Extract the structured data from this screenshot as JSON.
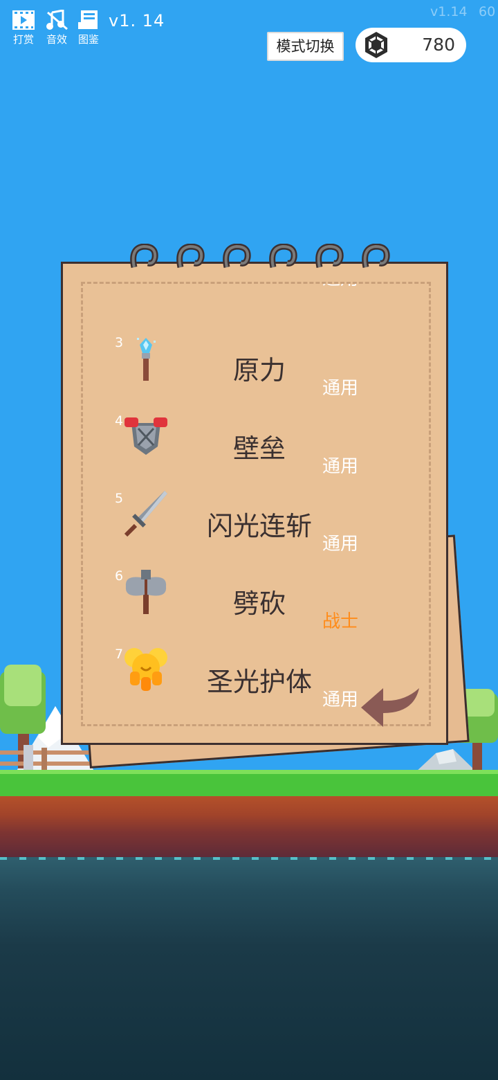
{
  "hud": {
    "buttons": [
      {
        "label": "打赏",
        "icon": "film-play-icon"
      },
      {
        "label": "音效",
        "icon": "music-muted-icon"
      },
      {
        "label": "图鉴",
        "icon": "book-icon"
      }
    ],
    "version": "v1. 14",
    "debug_version": "v1.14",
    "debug_fps": "60",
    "mode_switch_label": "模式切换",
    "gem_count": "780"
  },
  "skills": [
    {
      "index": "",
      "name": "",
      "tag": "通用",
      "tag_color": "#ffffff",
      "icon": "purple-potion-icon"
    },
    {
      "index": "3",
      "name": "原力",
      "tag": "通用",
      "tag_color": "#ffffff",
      "icon": "crystal-wand-icon"
    },
    {
      "index": "4",
      "name": "壁垒",
      "tag": "通用",
      "tag_color": "#ffffff",
      "icon": "armor-icon"
    },
    {
      "index": "5",
      "name": "闪光连斩",
      "tag": "通用",
      "tag_color": "#ffffff",
      "icon": "sword-icon"
    },
    {
      "index": "6",
      "name": "劈砍",
      "tag": "战士",
      "tag_color": "#ff8c1a",
      "icon": "axe-icon"
    },
    {
      "index": "7",
      "name": "圣光护体",
      "tag": "通用",
      "tag_color": "#ffffff",
      "icon": "holy-shield-icon"
    }
  ],
  "colors": {
    "sky": "#30a4f2",
    "paper": "#e9c196",
    "warrior_tag": "#ff8c1a"
  }
}
